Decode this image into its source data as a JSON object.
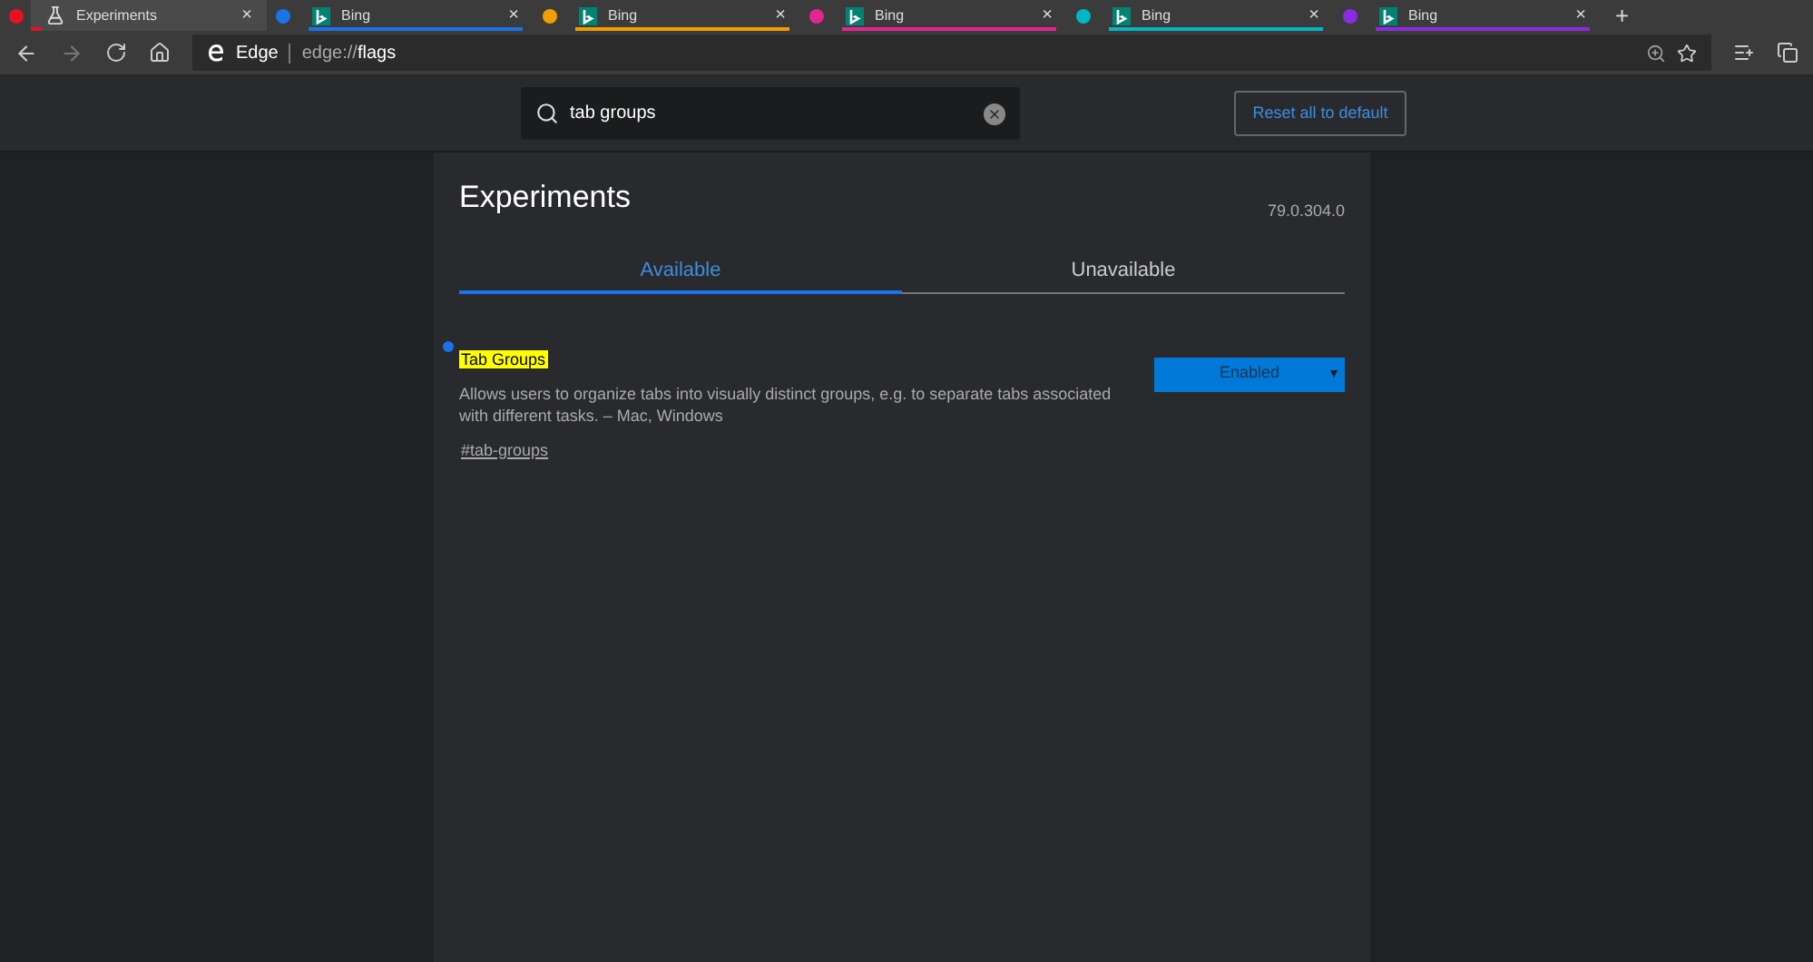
{
  "tabs": [
    {
      "title": "Experiments",
      "selected": true,
      "color": "#e81123",
      "kind": "flask",
      "close": "×"
    },
    {
      "title": "Bing",
      "selected": false,
      "color": "#1a73e8",
      "kind": "bing",
      "close": "×"
    },
    {
      "title": "Bing",
      "selected": false,
      "color": "#f29d00",
      "kind": "bing",
      "close": "×"
    },
    {
      "title": "Bing",
      "selected": false,
      "color": "#e3268f",
      "kind": "bing",
      "close": "×"
    },
    {
      "title": "Bing",
      "selected": false,
      "color": "#00b7c3",
      "kind": "bing",
      "close": "×"
    },
    {
      "title": "Bing",
      "selected": false,
      "color": "#8a2be2",
      "kind": "bing",
      "close": "×"
    }
  ],
  "new_tab": "+",
  "address": {
    "label": "Edge",
    "prefix": "edge://",
    "value": "flags"
  },
  "search": {
    "value": "tab groups"
  },
  "reset_button": "Reset all to default",
  "title": "Experiments",
  "version": "79.0.304.0",
  "view_tabs": [
    {
      "label": "Available",
      "selected": true
    },
    {
      "label": "Unavailable",
      "selected": false
    }
  ],
  "experiments": [
    {
      "name": "Tab Groups",
      "modified": true,
      "description": "Allows users to organize tabs into visually distinct groups, e.g. to separate tabs associated with different tasks. – Mac, Windows",
      "link": "#tab-groups",
      "value": "Enabled"
    }
  ]
}
